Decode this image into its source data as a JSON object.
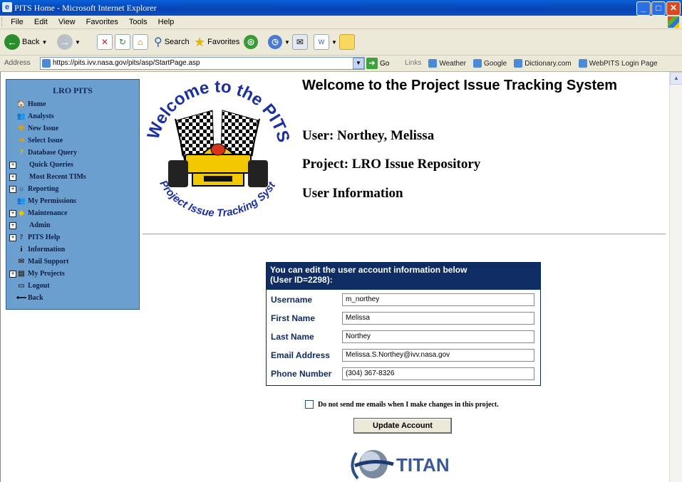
{
  "window": {
    "title": "PITS Home - Microsoft Internet Explorer"
  },
  "menu": [
    "File",
    "Edit",
    "View",
    "Favorites",
    "Tools",
    "Help"
  ],
  "toolbar": {
    "back_label": "Back",
    "search_label": "Search",
    "favorites_label": "Favorites"
  },
  "address": {
    "label": "Address",
    "url": "https://pits.ivv.nasa.gov/pits/asp/StartPage.asp",
    "go_label": "Go",
    "links_label": "Links"
  },
  "links": [
    "Weather",
    "Google",
    "Dictionary.com",
    "WebPITS Login Page"
  ],
  "sidebar": {
    "title": "LRO PITS",
    "items": [
      {
        "label": "Home",
        "expand": false,
        "icon": "home-icon"
      },
      {
        "label": "Analysts",
        "expand": false,
        "icon": "people-icon"
      },
      {
        "label": "New Issue",
        "expand": false,
        "icon": "new-issue-icon"
      },
      {
        "label": "Select Issue",
        "expand": false,
        "icon": "select-issue-icon"
      },
      {
        "label": "Database Query",
        "expand": false,
        "icon": "query-icon"
      },
      {
        "label": "Quick Queries",
        "expand": true,
        "icon": ""
      },
      {
        "label": "Most Recent TIMs",
        "expand": true,
        "icon": ""
      },
      {
        "label": "Reporting",
        "expand": true,
        "icon": "reporting-icon"
      },
      {
        "label": "My Permissions",
        "expand": false,
        "icon": "people-icon"
      },
      {
        "label": "Maintenance",
        "expand": true,
        "icon": "maintenance-icon"
      },
      {
        "label": "Admin",
        "expand": true,
        "icon": ""
      },
      {
        "label": "PITS Help",
        "expand": true,
        "icon": "help-icon"
      },
      {
        "label": "Information",
        "expand": false,
        "icon": "info-icon"
      },
      {
        "label": "Mail Support",
        "expand": false,
        "icon": "mail-icon"
      },
      {
        "label": "My Projects",
        "expand": true,
        "icon": "projects-icon"
      },
      {
        "label": "Logout",
        "expand": false,
        "icon": "logout-icon"
      },
      {
        "label": "Back",
        "expand": false,
        "icon": "back-arrow-icon"
      }
    ]
  },
  "logo": {
    "top_text": "Welcome to the PITS!",
    "bottom_text": "Project Issue Tracking System"
  },
  "main": {
    "title": "Welcome to the Project Issue Tracking System",
    "user_line": "User: Northey, Melissa",
    "project_line": "Project: LRO Issue Repository",
    "section_title": "User Information"
  },
  "form": {
    "header_line1": "You can edit the user account information below",
    "header_line2": "(User ID=2298):",
    "fields": [
      {
        "label": "Username",
        "value": "m_northey"
      },
      {
        "label": "First Name",
        "value": "Melissa"
      },
      {
        "label": "Last Name",
        "value": "Northey"
      },
      {
        "label": "Email Address",
        "value": "Melissa.S.Northey@ivv.nasa.gov"
      },
      {
        "label": "Phone Number",
        "value": "(304) 367-8326"
      }
    ],
    "checkbox_label": "Do not send me emails when I make changes in this project.",
    "checkbox_checked": false,
    "update_button": "Update Account"
  },
  "footer_logo": "TITAN",
  "colors": {
    "sidebar_bg": "#6b9fcf",
    "form_header_bg": "#0f2d63",
    "titlebar": "#0842b0"
  }
}
